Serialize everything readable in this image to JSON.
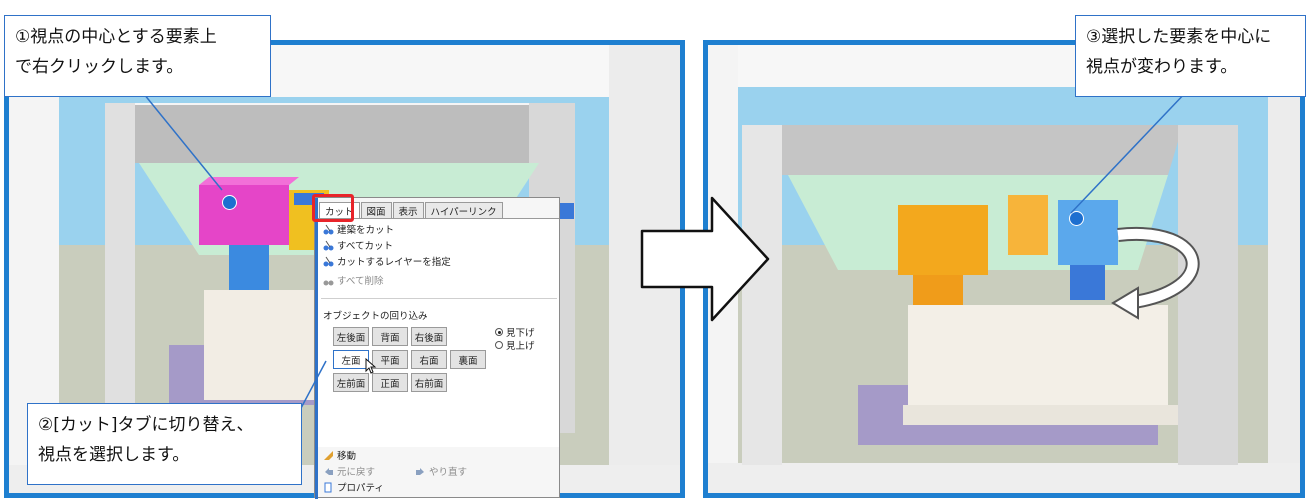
{
  "callouts": {
    "step1": "①視点の中心とする要素上\nで右クリックします。",
    "step2": "②[カット]タブに切り替え、\n視点を選択します。",
    "step3": "③選択した要素を中心に\n視点が変わります。"
  },
  "menu": {
    "tabs": [
      "カット",
      "図面",
      "表示",
      "ハイパーリンク"
    ],
    "cut_items": [
      "建築をカット",
      "すべてカット",
      "カットするレイヤーを指定",
      "すべて削除"
    ],
    "section_title": "オブジェクトの回り込み",
    "grid": [
      [
        "左後面",
        "背面",
        "右後面"
      ],
      [
        "左面",
        "平面",
        "右面",
        "裏面"
      ],
      [
        "左前面",
        "正面",
        "右前面"
      ]
    ],
    "radio": [
      "見下げ",
      "見上げ"
    ],
    "bottom_items": [
      "移動",
      "元に戻す",
      "やり直す",
      "プロパティ"
    ]
  },
  "colors": {
    "accent": "#1e7fd0",
    "highlight": "#e8242a",
    "callout_border": "#2f72c8"
  }
}
